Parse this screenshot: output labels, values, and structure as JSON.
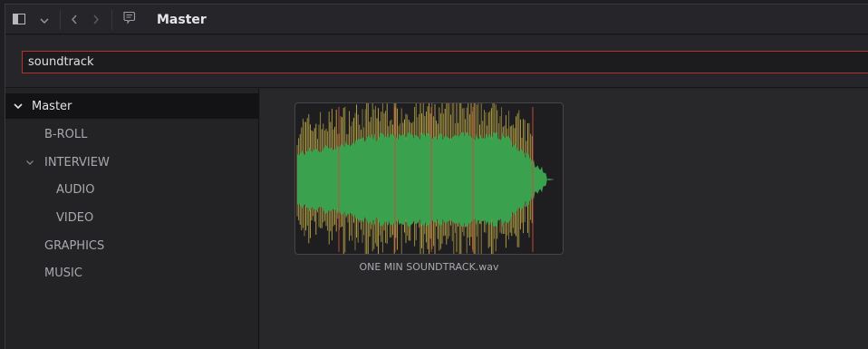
{
  "header": {
    "title": "Master"
  },
  "search": {
    "value": "soundtrack",
    "placeholder": ""
  },
  "sidebar": {
    "items": [
      {
        "label": "Master",
        "level": 0,
        "expanded": true,
        "selected": true
      },
      {
        "label": "B-ROLL",
        "level": 1
      },
      {
        "label": "INTERVIEW",
        "level": 1,
        "expanded": true
      },
      {
        "label": "AUDIO",
        "level": 2
      },
      {
        "label": "VIDEO",
        "level": 2
      },
      {
        "label": "GRAPHICS",
        "level": 1
      },
      {
        "label": "MUSIC",
        "level": 1
      }
    ]
  },
  "clips": [
    {
      "name": "ONE MIN SOUNDTRACK.wav",
      "waveform_color": "#3aa24e",
      "peak_color": "#c8b24a",
      "clip_color": "#d04a3a"
    }
  ],
  "colors": {
    "accent_border": "#b2322e",
    "selected_bg": "#131315"
  }
}
